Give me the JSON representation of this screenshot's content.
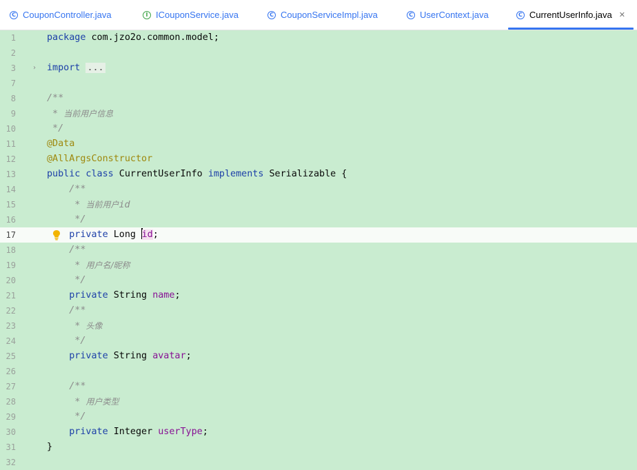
{
  "tabs": [
    {
      "label": "CouponController.java",
      "icon": "class-icon",
      "icon_glyph": "C",
      "color": "#3574f0",
      "active": false
    },
    {
      "label": "ICouponService.java",
      "icon": "interface-icon",
      "icon_glyph": "I",
      "color": "#3fa448",
      "active": false
    },
    {
      "label": "CouponServiceImpl.java",
      "icon": "class-icon",
      "icon_glyph": "C",
      "color": "#3574f0",
      "active": false
    },
    {
      "label": "UserContext.java",
      "icon": "class-icon",
      "icon_glyph": "C",
      "color": "#3574f0",
      "active": false
    },
    {
      "label": "CurrentUserInfo.java",
      "icon": "class-icon",
      "icon_glyph": "C",
      "color": "#3574f0",
      "active": true,
      "close": "✕"
    }
  ],
  "editor": {
    "current_line": "17",
    "lines": [
      {
        "n": "1",
        "t": "package com.jzo2o.common.model;"
      },
      {
        "n": "2",
        "t": ""
      },
      {
        "n": "3",
        "t": "import ..."
      },
      {
        "n": "7",
        "t": ""
      },
      {
        "n": "8",
        "t": "/**"
      },
      {
        "n": "9",
        "t": " * 当前用户信息"
      },
      {
        "n": "10",
        "t": " */"
      },
      {
        "n": "11",
        "t": "@Data"
      },
      {
        "n": "12",
        "t": "@AllArgsConstructor"
      },
      {
        "n": "13",
        "t": "public class CurrentUserInfo implements Serializable {"
      },
      {
        "n": "14",
        "t": "    /**"
      },
      {
        "n": "15",
        "t": "     * 当前用户id"
      },
      {
        "n": "16",
        "t": "     */"
      },
      {
        "n": "17",
        "t": "    private Long id;"
      },
      {
        "n": "18",
        "t": "    /**"
      },
      {
        "n": "19",
        "t": "     * 用户名/昵称"
      },
      {
        "n": "20",
        "t": "     */"
      },
      {
        "n": "21",
        "t": "    private String name;"
      },
      {
        "n": "22",
        "t": "    /**"
      },
      {
        "n": "23",
        "t": "     * 头像"
      },
      {
        "n": "24",
        "t": "     */"
      },
      {
        "n": "25",
        "t": "    private String avatar;"
      },
      {
        "n": "26",
        "t": ""
      },
      {
        "n": "27",
        "t": "    /**"
      },
      {
        "n": "28",
        "t": "     * 用户类型"
      },
      {
        "n": "29",
        "t": "     */"
      },
      {
        "n": "30",
        "t": "    private Integer userType;"
      },
      {
        "n": "31",
        "t": "}"
      },
      {
        "n": "32",
        "t": ""
      }
    ]
  },
  "colors": {
    "keyword": "#1c3fa8",
    "comment": "#8c8c8c",
    "annotation": "#9e880d",
    "field": "#871094",
    "editor_bg": "#c9ecd0",
    "accent": "#3574f0"
  }
}
